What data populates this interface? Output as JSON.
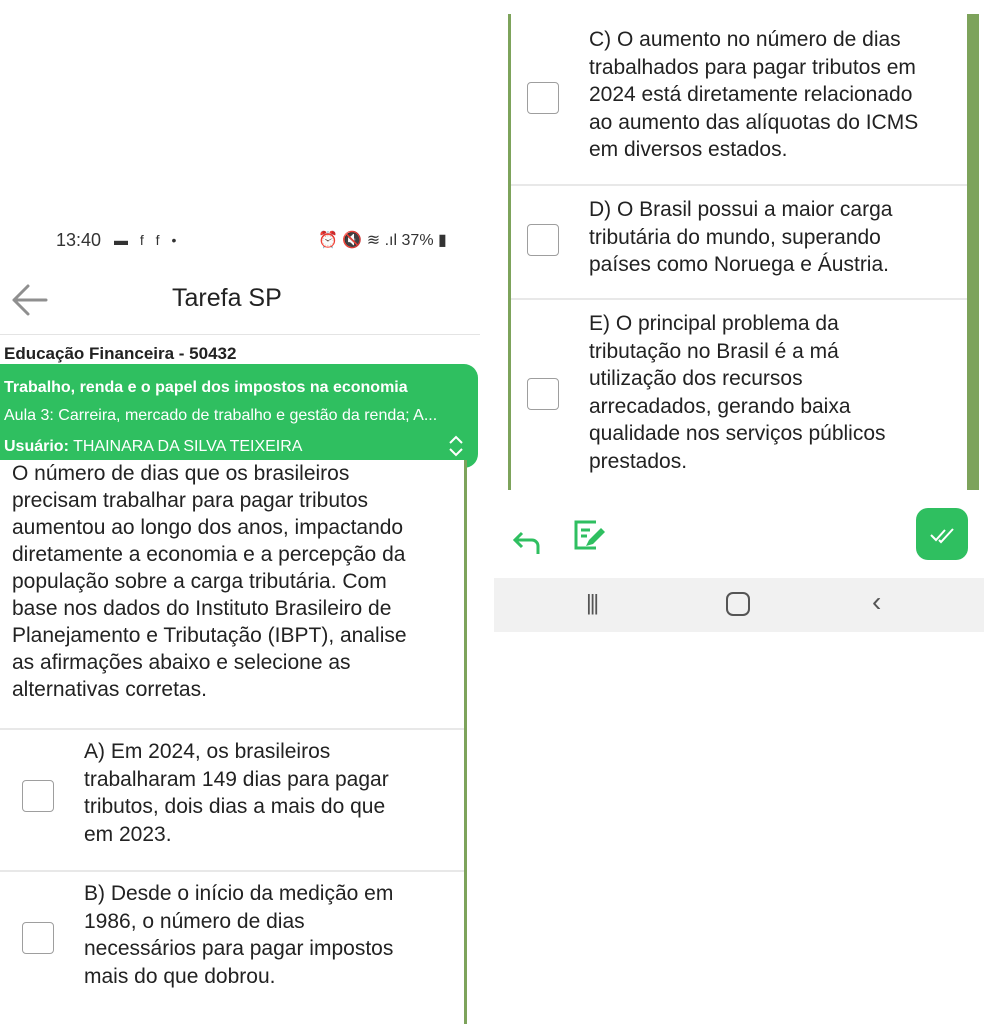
{
  "status": {
    "time": "13:40",
    "left_icons": "▬ f f •",
    "battery": "37%"
  },
  "app": {
    "title": "Tarefa SP"
  },
  "course": "Educação Financeira - 50432",
  "banner": {
    "topic": "Trabalho, renda e o papel dos impostos na economia",
    "lesson": "Aula 3: Carreira, mercado de trabalho e gestão da renda; A...",
    "user_label": "Usuário:",
    "user_name": "THAINARA DA SILVA TEIXEIRA"
  },
  "question": {
    "lines": [
      "O número de dias que os brasileiros",
      "precisam trabalhar para pagar tributos",
      "aumentou ao longo dos anos, impactando",
      "diretamente a economia e a percepção da",
      "população sobre a carga tributária. Com",
      "base nos dados do Instituto Brasileiro de",
      "Planejamento e Tributação (IBPT), analise",
      "as afirmações abaixo e selecione as",
      "alternativas corretas."
    ]
  },
  "options": {
    "a": [
      "A) Em 2024, os brasileiros",
      "trabalharam 149 dias para pagar",
      "tributos, dois dias a mais do que",
      "em 2023."
    ],
    "b": [
      "B) Desde o início da medição em",
      "1986, o número de dias",
      "necessários para pagar impostos",
      "mais do que dobrou."
    ],
    "c": [
      "C) O aumento no número de dias",
      "trabalhados para pagar tributos em",
      "2024 está diretamente relacionado",
      "ao aumento das alíquotas do ICMS",
      "em diversos estados."
    ],
    "d": [
      "D) O Brasil possui a maior carga",
      "tributária do mundo, superando",
      "países como Noruega e Áustria."
    ],
    "e": [
      "E) O principal problema da",
      "tributação no Brasil é a má",
      "utilização dos recursos",
      "arrecadados, gerando baixa",
      "qualidade nos serviços públicos",
      "prestados."
    ]
  },
  "icons": {
    "back": "arrow-left-icon",
    "reply": "reply-icon",
    "edit": "edit-note-icon",
    "confirm": "double-check-icon",
    "recent": "recent-apps-icon",
    "home": "home-icon",
    "nav_back": "chevron-left-icon"
  },
  "colors": {
    "accent": "#2fbf60",
    "frame": "#7da35b"
  }
}
